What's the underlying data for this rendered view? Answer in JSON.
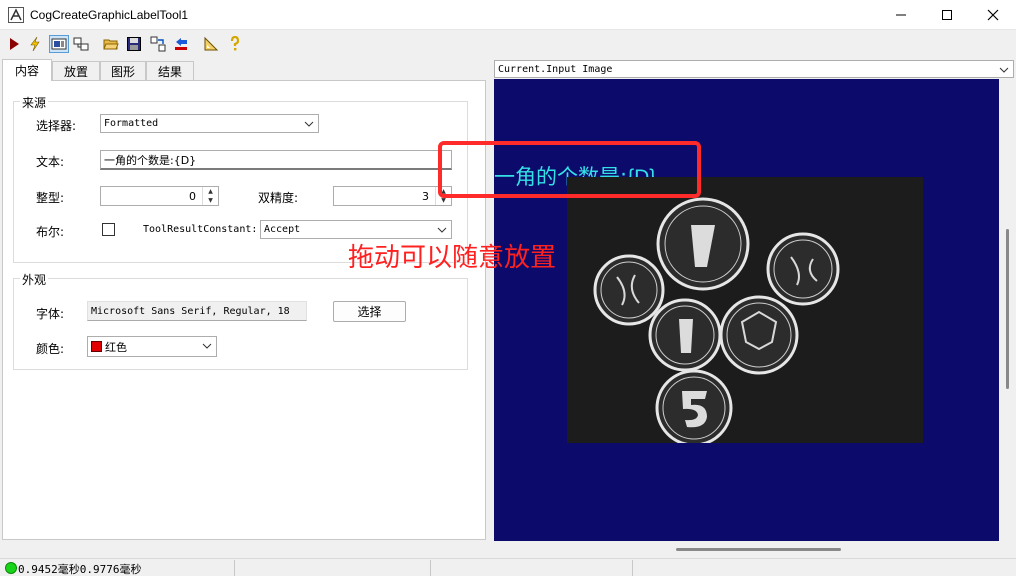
{
  "window": {
    "title": "CogCreateGraphicLabelTool1"
  },
  "toolbar": {
    "icons": [
      "run-icon",
      "electric-icon",
      "display-icon",
      "network-icon",
      "open-folder-icon",
      "save-icon",
      "export-icon",
      "import-icon",
      "ruler-icon",
      "help-icon"
    ]
  },
  "tabs": [
    {
      "label": "内容",
      "active": true
    },
    {
      "label": "放置",
      "active": false
    },
    {
      "label": "图形",
      "active": false
    },
    {
      "label": "结果",
      "active": false
    }
  ],
  "source_group": {
    "title": "来源",
    "selector_label": "选择器:",
    "selector_value": "Formatted",
    "text_label": "文本:",
    "text_value": "一角的个数是:{D}",
    "int_label": "整型:",
    "int_value": "0",
    "double_label": "双精度:",
    "double_value": "3",
    "bool_label": "布尔:",
    "trc_label": "ToolResultConstant:",
    "trc_value": "Accept"
  },
  "appearance_group": {
    "title": "外观",
    "font_label": "字体:",
    "font_value": "Microsoft Sans Serif, Regular, 18",
    "choose_button": "选择",
    "color_label": "颜色:",
    "color_value": "红色",
    "color_hex": "#e00000"
  },
  "image_viewer": {
    "selected_image": "Current.Input Image",
    "overlay_label_prefix": "一角的个数是:",
    "overlay_label_suffix": "{D}",
    "overlay_color": "#33e0e6",
    "background_color": "#0c0a6a"
  },
  "annotation": {
    "text": "拖动可以随意放置",
    "color": "#ff2020"
  },
  "status": {
    "text": "0.9452毫秒0.9776毫秒",
    "indicator_color": "#18d418"
  }
}
